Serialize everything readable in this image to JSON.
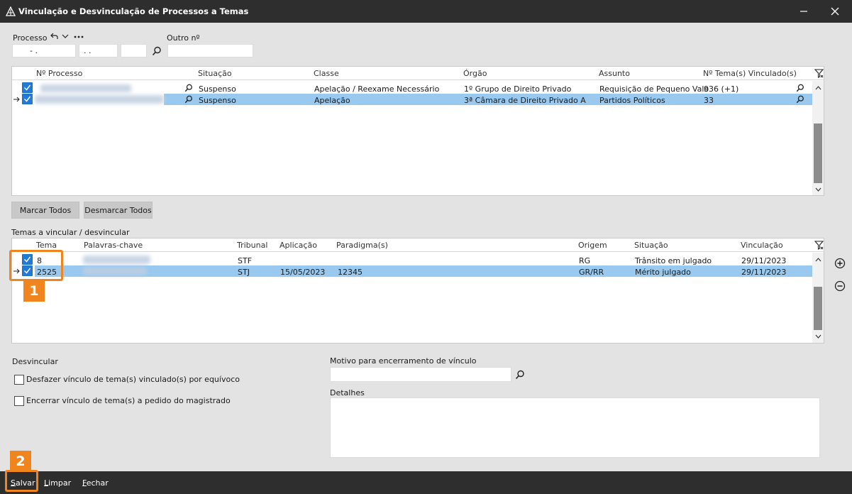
{
  "window": {
    "title": "Vinculação e Desvinculação de Processos a Temas"
  },
  "search": {
    "processo_label": "Processo",
    "outro_label": "Outro nº",
    "field1_value": "-   .",
    "field2_value": ".  .",
    "field3_value": "",
    "outro_value": ""
  },
  "processes": {
    "columns": [
      "Nº Processo",
      "Situação",
      "Classe",
      "Órgão",
      "Assunto",
      "Nº Tema(s) Vinculado(s)"
    ],
    "rows": [
      {
        "situacao": "Suspenso",
        "classe": "Apelação / Reexame Necessário",
        "orgao": "1º Grupo de Direito Privado",
        "assunto": "Requisição de Pequeno Valo",
        "temas": "936 (+1)",
        "checked": true,
        "current": false
      },
      {
        "situacao": "Suspenso",
        "classe": "Apelação",
        "orgao": "3ª Câmara de Direito Privado A",
        "assunto": "Partidos Políticos",
        "temas": "33",
        "checked": true,
        "current": true
      }
    ]
  },
  "buttons": {
    "marcar_todos": "Marcar Todos",
    "desmarcar_todos": "Desmarcar Todos"
  },
  "temas": {
    "section_label": "Temas a vincular / desvincular",
    "columns": [
      "Tema",
      "Palavras-chave",
      "Tribunal",
      "Aplicação",
      "Paradigma(s)",
      "Origem",
      "Situação",
      "Vinculação"
    ],
    "rows": [
      {
        "tema": "8",
        "tribunal": "STF",
        "aplicacao": "",
        "paradigma": "",
        "origem": "RG",
        "situacao": "Trânsito em julgado",
        "vinculacao": "29/11/2023",
        "checked": true,
        "current": false
      },
      {
        "tema": "2525",
        "tribunal": "STJ",
        "aplicacao": "15/05/2023",
        "paradigma": "12345",
        "origem": "GR/RR",
        "situacao": "Mérito julgado",
        "vinculacao": "29/11/2023",
        "checked": true,
        "current": true
      }
    ]
  },
  "desvincular": {
    "label": "Desvincular",
    "option1": "Desfazer vínculo de tema(s) vinculado(s) por equívoco",
    "option2": "Encerrar vínculo de tema(s) a pedido do magistrado"
  },
  "motivo": {
    "label": "Motivo para encerramento de vínculo",
    "value": ""
  },
  "detalhes": {
    "label": "Detalhes",
    "value": ""
  },
  "footer": {
    "salvar": "Salvar",
    "limpar": "Limpar",
    "fechar": "Fechar"
  },
  "callouts": {
    "one": "1",
    "two": "2"
  },
  "colors": {
    "titlebar": "#2e2e2e",
    "selection": "#99c9ef",
    "checkbox": "#1f7bd6",
    "callout": "#f0841e"
  }
}
